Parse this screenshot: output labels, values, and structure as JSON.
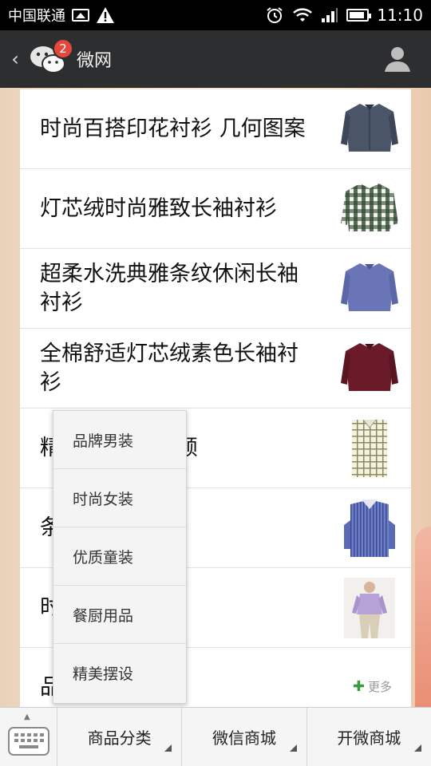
{
  "status_bar": {
    "carrier": "中国联通",
    "time": "11:10",
    "icons": [
      "image-icon",
      "warning-icon",
      "alarm-icon",
      "wifi-icon",
      "signal-icon",
      "battery-icon"
    ]
  },
  "header": {
    "back_icon": "chevron-left-icon",
    "app_icon": "wechat-icon",
    "badge_count": "2",
    "title": "微网",
    "profile_icon": "person-icon"
  },
  "list": {
    "items": [
      {
        "title": "时尚百搭印花衬衫 几何图案",
        "thumb": "navy-shirt"
      },
      {
        "title": "灯芯绒时尚雅致长袖衬衫",
        "thumb": "plaid-shirt"
      },
      {
        "title": "超柔水洗典雅条纹休闲长袖衬衫",
        "thumb": "blue-shirt"
      },
      {
        "title": "全棉舒适灯芯绒素色长袖衬衫",
        "thumb": "burgundy-shirt"
      },
      {
        "title": "精                                   烫长袖衬衫领",
        "thumb": "check-shirt"
      },
      {
        "title": "条                                   保暖衬衫",
        "thumb": "striped-shirt"
      },
      {
        "title": "时                                   长袖衬衫",
        "thumb": "model-photo"
      },
      {
        "title": "品",
        "more_label": "更多"
      }
    ]
  },
  "popup_menu": {
    "items": [
      "品牌男装",
      "时尚女装",
      "优质童装",
      "餐厨用品",
      "精美摆设"
    ]
  },
  "bottom_bar": {
    "keyboard_icon": "keyboard-icon",
    "tabs": [
      "商品分类",
      "微信商城",
      "开微商城"
    ]
  }
}
